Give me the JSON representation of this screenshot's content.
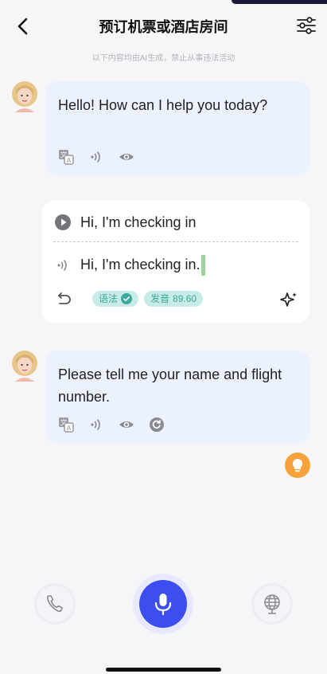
{
  "header": {
    "title": "预订机票或酒店房间",
    "back_icon": "chevron-left-icon",
    "settings_icon": "sliders-icon"
  },
  "disclaimer": "以下内容均由AI生成，禁止从事违法活动",
  "messages": [
    {
      "role": "assistant",
      "text": "Hello! How can I help you today?",
      "icons": [
        "translate-icon",
        "audio-icon",
        "eye-icon"
      ]
    },
    {
      "role": "user",
      "original": "Hi, I'm checking in",
      "transcribed": "Hi, I'm checking in.",
      "tags": {
        "grammar_label": "语法",
        "pronunciation_label": "发音",
        "pronunciation_score": "89.60"
      }
    },
    {
      "role": "assistant",
      "text": "Please tell me your name and flight number.",
      "icons": [
        "translate-icon",
        "audio-icon",
        "eye-icon",
        "refresh-icon"
      ]
    }
  ],
  "colors": {
    "accent": "#3c4ef0",
    "assistant_bubble": "#ebf1ff",
    "tag_bg": "#c8ebe7",
    "tag_text": "#3aa89c",
    "bulb": "#f6a23c"
  }
}
